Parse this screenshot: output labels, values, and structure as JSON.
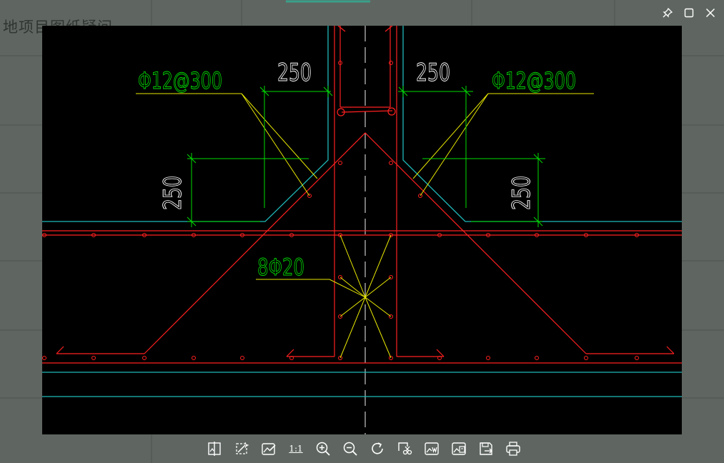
{
  "background": {
    "doc_title": "地项目图纸疑问"
  },
  "window_controls": {
    "pin": "pin-icon",
    "maximize": "maximize-icon",
    "close": "close-icon"
  },
  "drawing": {
    "dim_top_left": "250",
    "dim_top_right": "250",
    "dim_side_left": "250",
    "dim_side_right": "250",
    "rebar_left": "Φ12@300",
    "rebar_right": "Φ12@300",
    "rebar_center": "8Φ20",
    "colors": {
      "rebar": "#ff2020",
      "outline": "#1fb8b8",
      "dimension": "#00dd00",
      "leader": "#e8e800",
      "axis": "#c8c8c8"
    }
  },
  "toolbar": {
    "actual_size_label": "1:1",
    "buttons": [
      "compare-icon",
      "magic-wand-icon",
      "edit-image-icon",
      "actual-size",
      "zoom-in-icon",
      "zoom-out-icon",
      "rotate-icon",
      "crop-icon",
      "image-text-icon",
      "image-convert-icon",
      "save-as-icon",
      "print-icon"
    ]
  }
}
